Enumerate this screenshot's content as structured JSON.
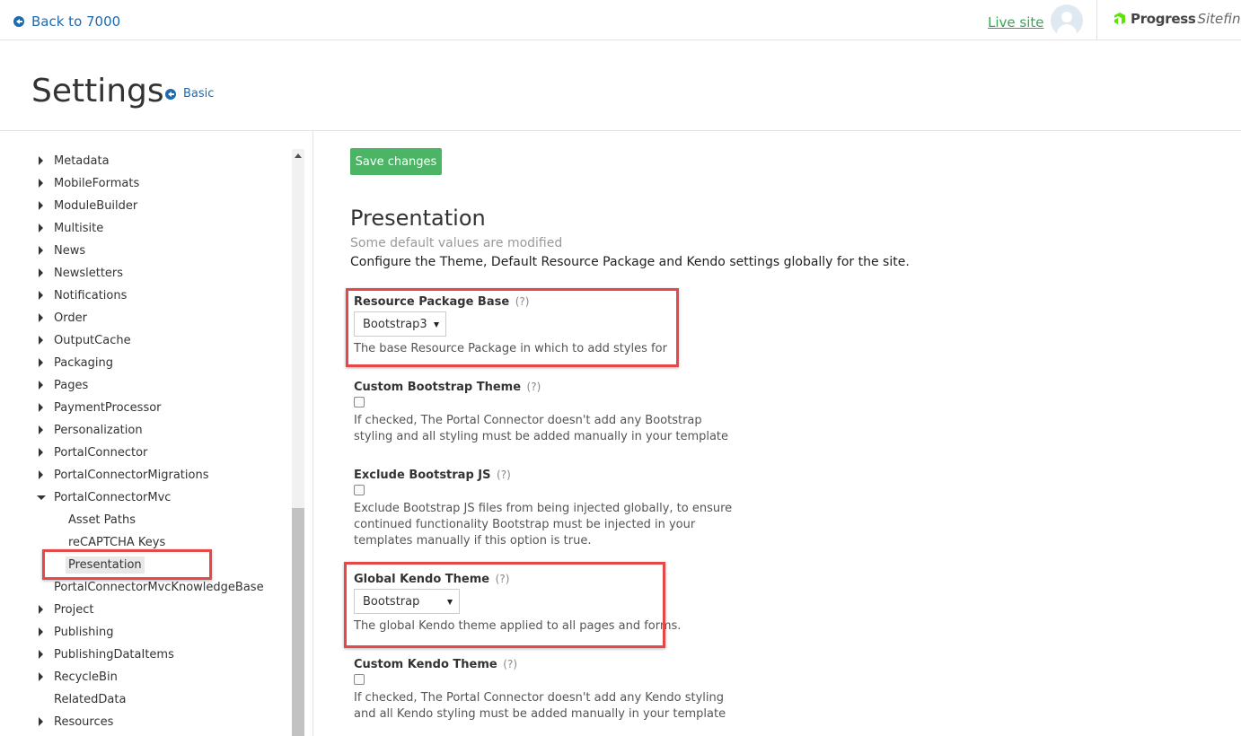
{
  "topbar": {
    "back_label": "Back to 7000",
    "live_site_label": "Live site",
    "brand_progress": "Progress",
    "brand_sitefinity": "Sitefinity",
    "brand_tm": "™"
  },
  "header": {
    "title": "Settings",
    "basic_label": "Basic"
  },
  "sidebar": {
    "items": [
      {
        "label": "Metadata",
        "caret": "collapsed"
      },
      {
        "label": "MobileFormats",
        "caret": "collapsed"
      },
      {
        "label": "ModuleBuilder",
        "caret": "collapsed"
      },
      {
        "label": "Multisite",
        "caret": "collapsed"
      },
      {
        "label": "News",
        "caret": "collapsed"
      },
      {
        "label": "Newsletters",
        "caret": "collapsed"
      },
      {
        "label": "Notifications",
        "caret": "collapsed"
      },
      {
        "label": "Order",
        "caret": "collapsed"
      },
      {
        "label": "OutputCache",
        "caret": "collapsed"
      },
      {
        "label": "Packaging",
        "caret": "collapsed"
      },
      {
        "label": "Pages",
        "caret": "collapsed"
      },
      {
        "label": "PaymentProcessor",
        "caret": "collapsed"
      },
      {
        "label": "Personalization",
        "caret": "collapsed"
      },
      {
        "label": "PortalConnector",
        "caret": "collapsed"
      },
      {
        "label": "PortalConnectorMigrations",
        "caret": "collapsed"
      },
      {
        "label": "PortalConnectorMvc",
        "caret": "expanded"
      },
      {
        "label": "Asset Paths",
        "caret": "none",
        "child": true
      },
      {
        "label": "reCAPTCHA Keys",
        "caret": "none",
        "child": true
      },
      {
        "label": "Presentation",
        "caret": "none",
        "child": true,
        "selected": true
      },
      {
        "label": "PortalConnectorMvcKnowledgeBase",
        "caret": "none"
      },
      {
        "label": "Project",
        "caret": "collapsed"
      },
      {
        "label": "Publishing",
        "caret": "collapsed"
      },
      {
        "label": "PublishingDataItems",
        "caret": "collapsed"
      },
      {
        "label": "RecycleBin",
        "caret": "collapsed"
      },
      {
        "label": "RelatedData",
        "caret": "none"
      },
      {
        "label": "Resources",
        "caret": "collapsed"
      }
    ]
  },
  "main": {
    "save_label": "Save changes",
    "section_title": "Presentation",
    "section_subtitle": "Some default values are modified",
    "section_description": "Configure the Theme, Default Resource Package and Kendo settings globally for the site.",
    "help_marker": "(?)",
    "fields": {
      "resource_package": {
        "label": "Resource Package Base",
        "value": "Bootstrap3",
        "hint": "The base Resource Package in which to add styles for"
      },
      "custom_bootstrap": {
        "label": "Custom Bootstrap Theme",
        "checked": false,
        "hint_line1": "If checked, The Portal Connector doesn't add any Bootstrap",
        "hint_line2": "styling and all styling must be added manually in your template"
      },
      "exclude_bootstrap_js": {
        "label": "Exclude Bootstrap JS",
        "checked": false,
        "hint_line1": "Exclude Bootstrap JS files from being injected globally, to ensure",
        "hint_line2": "continued functionality Bootstrap must be injected in your",
        "hint_line3": "templates manually if this option is true."
      },
      "global_kendo_theme": {
        "label": "Global Kendo Theme",
        "value": "Bootstrap",
        "hint": "The global Kendo theme applied to all pages and forms."
      },
      "custom_kendo_theme": {
        "label": "Custom Kendo Theme",
        "checked": false,
        "hint_line1": "If checked, The Portal Connector doesn't add any Kendo styling",
        "hint_line2": "and all Kendo styling must be added manually in your template"
      }
    }
  },
  "colors": {
    "link_blue": "#1c6ab0",
    "live_site_green": "#3aa655",
    "save_green": "#4cb565",
    "highlight_red": "#e44848"
  }
}
